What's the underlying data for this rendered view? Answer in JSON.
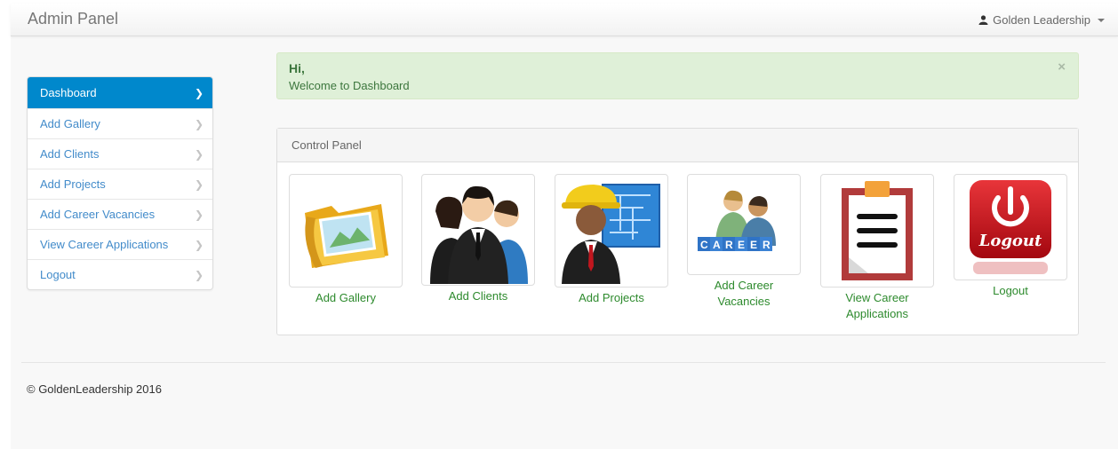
{
  "navbar": {
    "brand": "Admin Panel",
    "user_name": "Golden Leadership"
  },
  "sidebar": {
    "items": [
      {
        "label": "Dashboard",
        "active": true
      },
      {
        "label": "Add Gallery"
      },
      {
        "label": "Add Clients"
      },
      {
        "label": "Add Projects"
      },
      {
        "label": "Add Career Vacancies"
      },
      {
        "label": "View Career Applications"
      },
      {
        "label": "Logout"
      }
    ]
  },
  "alert": {
    "title": "Hi,",
    "text": "Welcome to Dashboard",
    "close": "×"
  },
  "panel": {
    "heading": "Control Panel",
    "tiles": [
      {
        "label": "Add Gallery",
        "icon": "folder-gallery-icon"
      },
      {
        "label": "Add Clients",
        "icon": "people-group-icon"
      },
      {
        "label": "Add Projects",
        "icon": "engineer-blueprint-icon"
      },
      {
        "label": "Add Career Vacancies",
        "icon": "career-people-icon"
      },
      {
        "label": "View Career Applications",
        "icon": "clipboard-icon"
      },
      {
        "label": "Logout",
        "icon": "power-logout-icon",
        "badge_text": "Logout"
      }
    ]
  },
  "footer": {
    "text": "© GoldenLeadership 2016"
  },
  "colors": {
    "accent": "#0088cc",
    "link": "#428bca",
    "alert_bg": "#dff0d8",
    "alert_text": "#3c763d",
    "tile_label": "#2d8a2d"
  }
}
